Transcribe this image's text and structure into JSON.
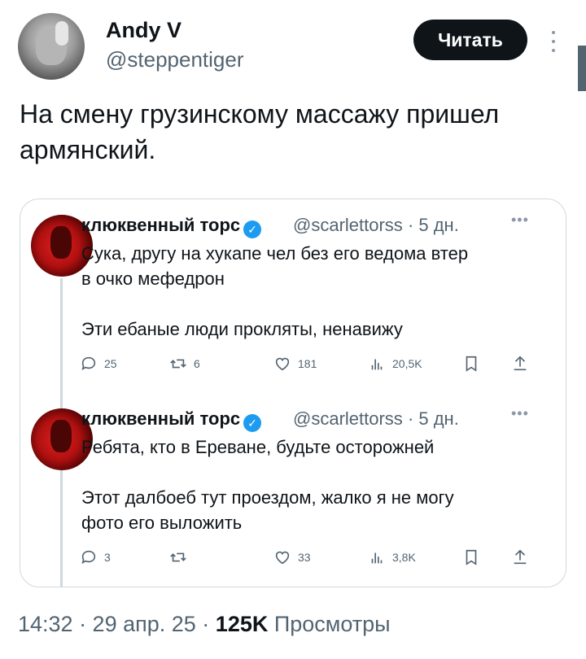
{
  "author": {
    "display_name": "Andy V",
    "handle": "@steppentiger",
    "follow_label": "Читать"
  },
  "tweet": {
    "text": "На смену грузинскому массажу пришел армянский."
  },
  "quoted_thread": [
    {
      "name": "клюквенный торс",
      "handle": "@scarlettorss",
      "age": "· 5 дн.",
      "text": "Сука, другу на хукапе чел без его ведома втер\nв очко мефедрон\n\nЭти ебаные люди прокляты, ненавижу",
      "replies": "25",
      "reposts": "6",
      "likes": "181",
      "views": "20,5K"
    },
    {
      "name": "клюквенный торс",
      "handle": "@scarlettorss",
      "age": "· 5 дн.",
      "text": "Ребята, кто в Ереване, будьте осторожней\n\nЭтот далбоеб тут проездом, жалко я не могу\nфото его выложить",
      "replies": "3",
      "reposts": "",
      "likes": "33",
      "views": "3,8K"
    }
  ],
  "footer": {
    "time": "14:32 · 29 апр. 25 ·",
    "views_count": "125K",
    "views_label": "Просмотры"
  },
  "colors": {
    "text": "#0f1419",
    "secondary": "#536471",
    "verified": "#1d9bf0",
    "border": "#cfd9de"
  },
  "icons": [
    "reply-icon",
    "repost-icon",
    "like-icon",
    "views-icon",
    "bookmark-icon",
    "share-icon",
    "verified-icon",
    "more-icon"
  ]
}
